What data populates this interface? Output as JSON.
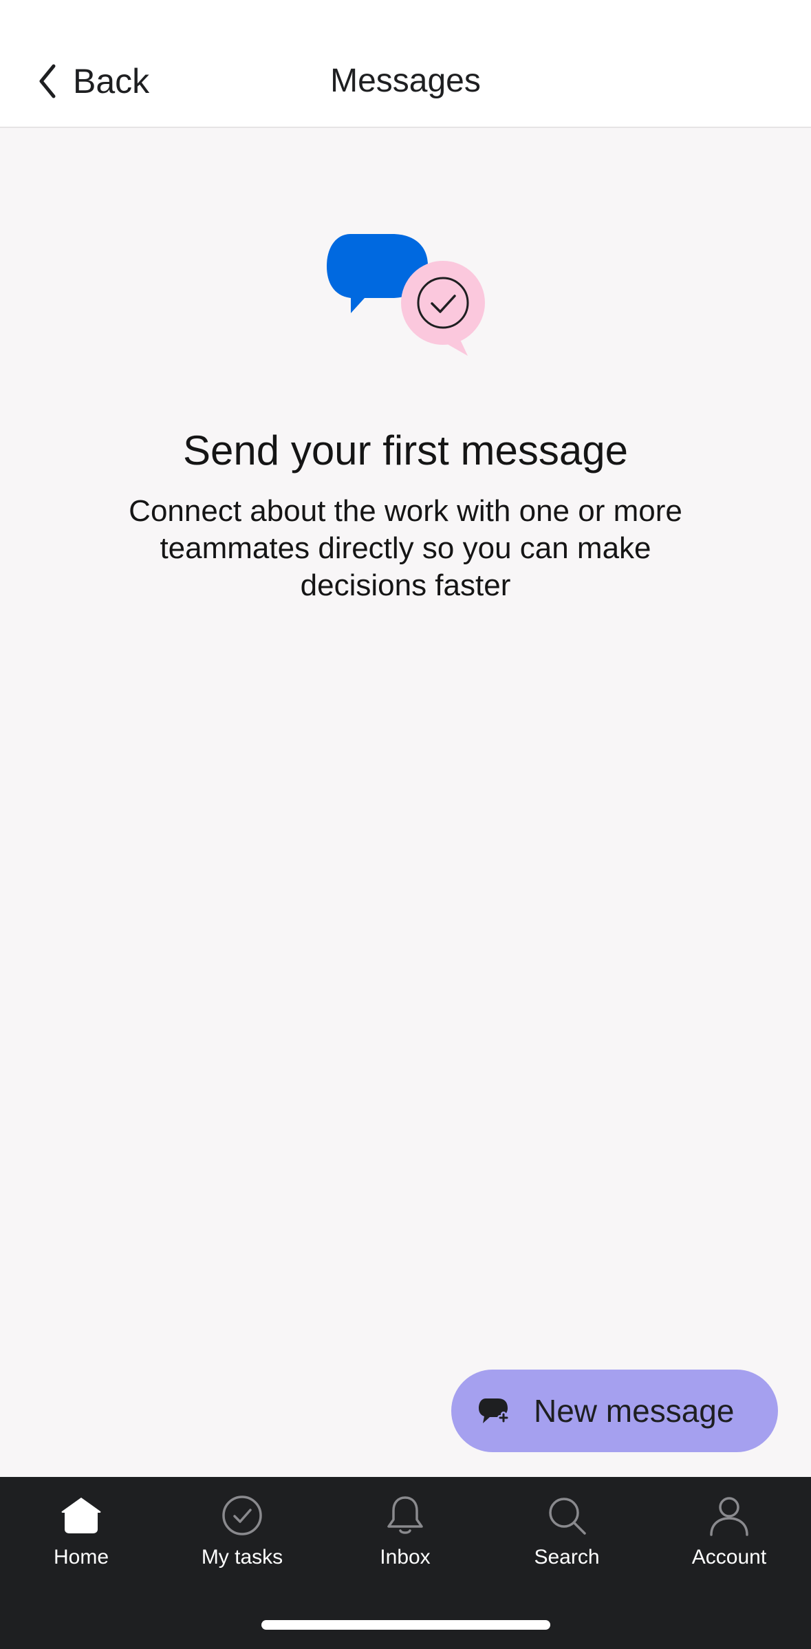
{
  "header": {
    "back_label": "Back",
    "title": "Messages"
  },
  "empty_state": {
    "heading": "Send your first message",
    "description": "Connect about the work with one or more teammates directly so you can make decisions faster"
  },
  "fab": {
    "label": "New message",
    "icon": "new-message-icon"
  },
  "tabs": [
    {
      "label": "Home",
      "icon": "home-icon",
      "active": true
    },
    {
      "label": "My tasks",
      "icon": "check-circle-icon"
    },
    {
      "label": "Inbox",
      "icon": "bell-icon"
    },
    {
      "label": "Search",
      "icon": "search-icon"
    },
    {
      "label": "Account",
      "icon": "person-icon"
    }
  ],
  "colors": {
    "fab_bg": "#a5a0ef",
    "tabbar_bg": "#1e1f21",
    "bubble_blue": "#0069e0",
    "bubble_pink": "#fbc8dd"
  }
}
